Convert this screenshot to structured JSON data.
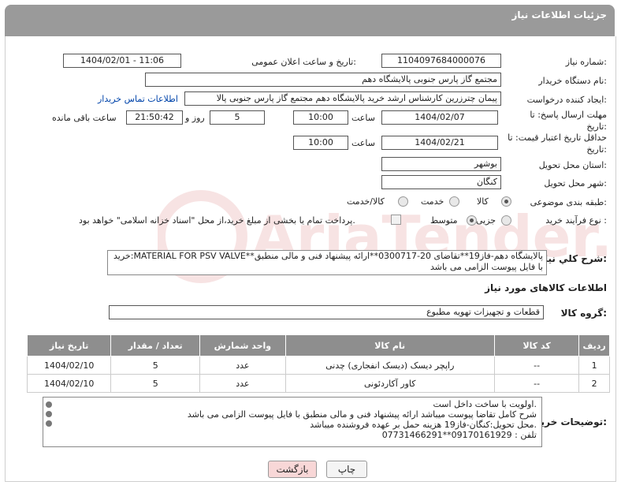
{
  "header": {
    "title": "جزئیات اطلاعات نیاز"
  },
  "fields": {
    "need_number_label": "شماره نیاز:",
    "need_number": "1104097684000076",
    "announce_label": "تاریخ و ساعت اعلان عمومی:",
    "announce_value": "1404/02/01 - 11:06",
    "buyer_org_label": "نام دستگاه خریدار:",
    "buyer_org": "مجتمع گاز پارس جنوبی  پالایشگاه دهم",
    "requester_label": "ایجاد کننده درخواست:",
    "requester": "پیمان چترزرین کارشناس ارشد خرید پالایشگاه دهم مجتمع گاز پارس جنوبی  پالا",
    "contact_link": "اطلاعات تماس خریدار",
    "deadline_label": "مهلت ارسال پاسخ: تا تاریخ:",
    "deadline_date": "1404/02/07",
    "time_label": "ساعت",
    "deadline_time": "10:00",
    "days": "5",
    "days_label": "روز و",
    "remaining_time": "21:50:42",
    "remaining_label": "ساعت باقی مانده",
    "validity_label": "حداقل تاریخ اعتبار قیمت: تا تاریخ:",
    "validity_date": "1404/02/21",
    "validity_time": "10:00",
    "province_label": "استان محل تحویل:",
    "province": "بوشهر",
    "city_label": "شهر محل تحویل:",
    "city": "کنگان",
    "category_label": "طبقه بندی موضوعی:",
    "cat_goods": "کالا",
    "cat_service": "خدمت",
    "cat_both": "کالا/خدمت",
    "process_label": "نوع فرآیند خرید :",
    "proc_minor": "جزیی",
    "proc_medium": "متوسط",
    "payment_note": "پرداخت تمام یا بخشی از مبلغ خرید،از محل \"اسناد خزانه اسلامی\" خواهد بود.",
    "description_label": "شرح کلي نياز:",
    "description": "خرید:MATERIAL FOR PSV VALVE**پالایشگاه دهم-فاز19**تقاضای 20-0300717**ارائه پیشنهاد فنی و مالی منطبق با فایل پیوست الزامی می باشد",
    "goods_info_title": "اطلاعات کالاهای مورد نیاز",
    "goods_group_label": "گروه کالا:",
    "goods_group": "قطعات و تجهیزات تهویه مطبوع"
  },
  "table": {
    "headers": [
      "ردیف",
      "کد کالا",
      "نام کالا",
      "واحد شمارش",
      "تعداد / مقدار",
      "تاریخ نیاز"
    ],
    "rows": [
      [
        "1",
        "--",
        "راپچر دیسک (دیسک انفجاری) چدنی",
        "عدد",
        "5",
        "1404/02/10"
      ],
      [
        "2",
        "--",
        "کاور آکاردئونی",
        "عدد",
        "5",
        "1404/02/10"
      ]
    ]
  },
  "buyer_notes": {
    "label": "توضیحات خریدار:",
    "lines": [
      "اولویت با ساخت داخل است.",
      "شرح کامل تقاضا پیوست میباشد ارائه پیشنهاد فنی و مالی منطبق با فایل پیوست الزامی می باشد",
      "محل تحویل:کنگان-فاز19 هزینه حمل بر عهده فروشنده میباشد.",
      "تلفن : 09170161929**07731466291"
    ]
  },
  "buttons": {
    "print": "چاپ",
    "back": "بازگشت"
  },
  "watermark": "AriaTender.neT"
}
